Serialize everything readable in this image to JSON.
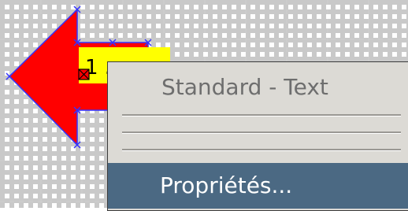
{
  "shape": {
    "type": "left-arrow",
    "fill_color": "#ff0000",
    "handle_color": "#3333ff",
    "text_box_color": "#ffff00",
    "text_box_label": "1 ...",
    "anchor_icon": "anchor-marker-icon"
  },
  "context_menu": {
    "header": "Standard - Text",
    "separators": 3,
    "items": [
      {
        "label": "Propriétés...",
        "selected": true
      }
    ],
    "highlight_color": "#4b6983"
  }
}
